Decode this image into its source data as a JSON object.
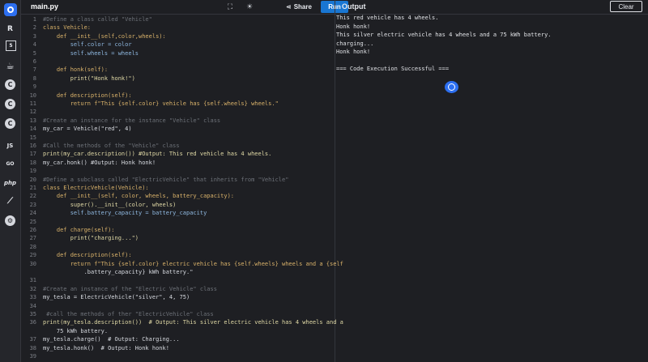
{
  "editor": {
    "file_tab": "main.py",
    "share_label": "Share",
    "run_label": "Run"
  },
  "output": {
    "title": "Output",
    "clear_label": "Clear",
    "lines": [
      "This red vehicle has 4 wheels.",
      "Honk honk!",
      "This silver electric vehicle has 4 wheels and a 75 kWh battery.",
      "charging...",
      "Honk honk!",
      "",
      "=== Code Execution Successful ==="
    ]
  },
  "sidebar": {
    "icons": [
      "python-logo",
      "r-icon",
      "html5-icon",
      "java-icon",
      "c-icon",
      "cpp-icon",
      "csharp-icon",
      "js-icon",
      "go-icon",
      "php-icon",
      "swift-icon",
      "rust-icon"
    ],
    "labels": {
      "js": "JS",
      "go": "GO",
      "php": "php",
      "r": "R"
    }
  },
  "code": {
    "line_numbers": [
      "1",
      "2",
      "3",
      "4",
      "5",
      "6",
      "7",
      "8",
      "9",
      "10",
      "11",
      "12",
      "13",
      "14",
      "15",
      "16",
      "17",
      "18",
      "19",
      "20",
      "21",
      "22",
      "23",
      "24",
      "25",
      "26",
      "27",
      "28",
      "29",
      "30",
      "",
      "31",
      "32",
      "33",
      "34",
      "35",
      "36",
      "",
      "37",
      "38",
      "39"
    ],
    "lines": [
      "#Define a class called \"Vehicle\"",
      "class Vehicle:",
      "    def __init__(self,color,wheels):",
      "        self.color = color",
      "        self.wheels = wheels",
      "",
      "    def honk(self):",
      "        print(\"Honk honk!\")",
      "",
      "    def description(self):",
      "        return f\"This {self.color} vehicle has {self.wheels} wheels.\"",
      "",
      "#Create an instance for the instance \"Vehicle\" class",
      "my_car = Vehicle(\"red\", 4)",
      "",
      "#Call the methods of the \"Vehicle\" class",
      "print(my_car.description()) #Output: This red vehicle has 4 wheels.",
      "my_car.honk() #Output: Honk honk!",
      "",
      "#Define a subclass called \"ElectricVehicle\" that inherits from \"Vehicle\"",
      "class ElectricVehicle(Vehicle):",
      "    def __init__(self, color, wheels, battery_capacity):",
      "        super().__init__(color, wheels)",
      "        self.battery_capacity = battery_capacity",
      "",
      "    def charge(self):",
      "        print(\"charging...\")",
      "",
      "    def description(self):",
      "        return f\"This {self.color} electric vehicle has {self.wheels} wheels and a {self",
      "            .battery_capacity} kWh battery.\"",
      "",
      "#Create an instance of the \"Electric Vehicle\" class",
      "my_tesla = ElectricVehicle(\"silver\", 4, 75)",
      "",
      " #call the methods of ther \"ElectricVehicle\" class",
      "print(my_tesla.description())  # Output: This silver electric vehicle has 4 wheels and a",
      "    75 kWh battery.",
      "my_tesla.charge()  # Output: Charging...",
      "my_tesla.honk()  # Output: Honk honk!",
      ""
    ]
  }
}
